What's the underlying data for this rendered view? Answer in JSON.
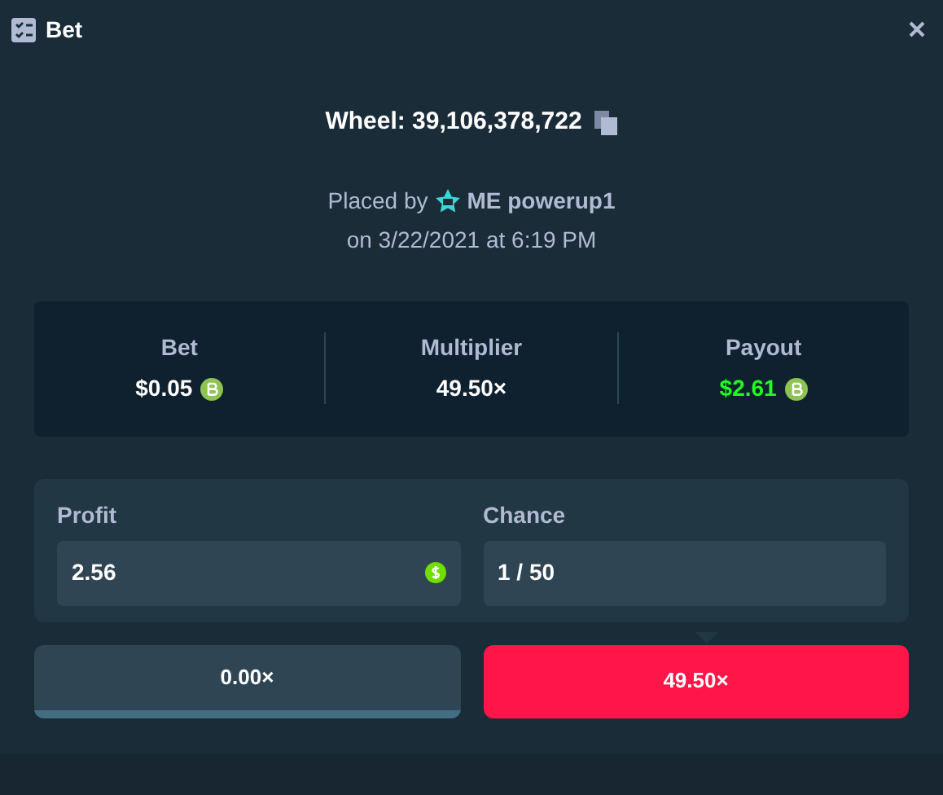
{
  "window": {
    "title": "Bet"
  },
  "game": {
    "label": "Wheel: 39,106,378,722"
  },
  "placed": {
    "prefix": "Placed by",
    "user": "ME powerup1",
    "date": "on 3/22/2021 at 6:19 PM"
  },
  "stats": [
    {
      "label": "Bet",
      "value": "$0.05",
      "coin": true,
      "highlight": false
    },
    {
      "label": "Multiplier",
      "value": "49.50×",
      "coin": false,
      "highlight": false
    },
    {
      "label": "Payout",
      "value": "$2.61",
      "coin": true,
      "highlight": true
    }
  ],
  "fields": [
    {
      "label": "Profit",
      "value": "2.56",
      "currency_icon": true
    },
    {
      "label": "Chance",
      "value": "1 / 50",
      "currency_icon": false
    }
  ],
  "segments": [
    {
      "label": "0.00×",
      "color": "#426d82",
      "selected": false
    },
    {
      "label": "49.50×",
      "color": "#ff1548",
      "selected": true
    }
  ]
}
